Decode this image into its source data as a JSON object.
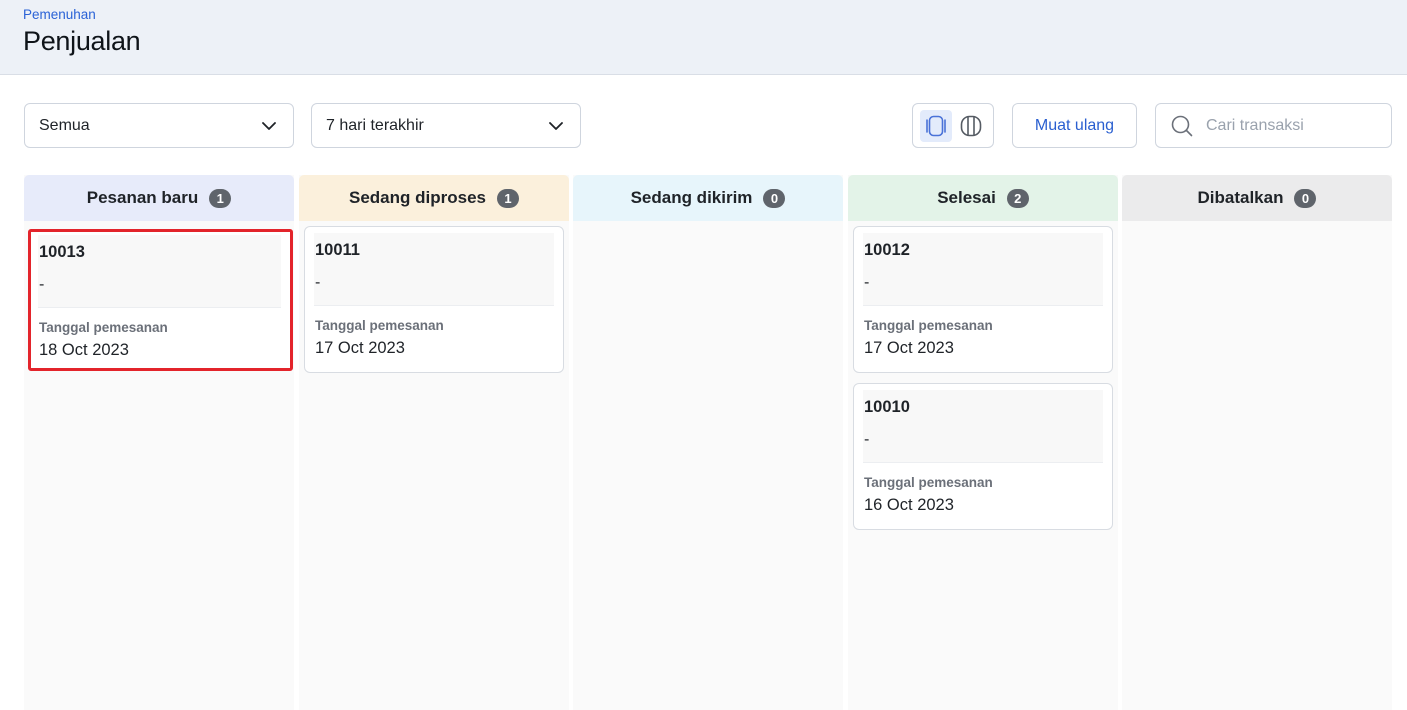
{
  "header": {
    "breadcrumb": "Pemenuhan",
    "title": "Penjualan"
  },
  "toolbar": {
    "status_filter": "Semua",
    "date_range": "7 hari terakhir",
    "reload_label": "Muat ulang",
    "search_placeholder": "Cari transaksi",
    "active_view": "card-view"
  },
  "columns": [
    {
      "title": "Pesanan baru",
      "count": "1",
      "color": "#e7ebfa",
      "cards": [
        {
          "id": "10013",
          "desc": "-",
          "date_label": "Tanggal pemesanan",
          "date": "18 Oct 2023",
          "highlighted": true
        }
      ]
    },
    {
      "title": "Sedang diproses",
      "count": "1",
      "color": "#fbf0dc",
      "cards": [
        {
          "id": "10011",
          "desc": "-",
          "date_label": "Tanggal pemesanan",
          "date": "17 Oct 2023"
        }
      ]
    },
    {
      "title": "Sedang dikirim",
      "count": "0",
      "color": "#e7f5fb",
      "cards": []
    },
    {
      "title": "Selesai",
      "count": "2",
      "color": "#e3f3e8",
      "cards": [
        {
          "id": "10012",
          "desc": "-",
          "date_label": "Tanggal pemesanan",
          "date": "17 Oct 2023"
        },
        {
          "id": "10010",
          "desc": "-",
          "date_label": "Tanggal pemesanan",
          "date": "16 Oct 2023"
        }
      ]
    },
    {
      "title": "Dibatalkan",
      "count": "0",
      "color": "#ebebec",
      "cards": []
    }
  ],
  "colors": {
    "accent": "#2a5fd0",
    "highlight": "#e3242b",
    "count_badge": "#5f646b"
  }
}
